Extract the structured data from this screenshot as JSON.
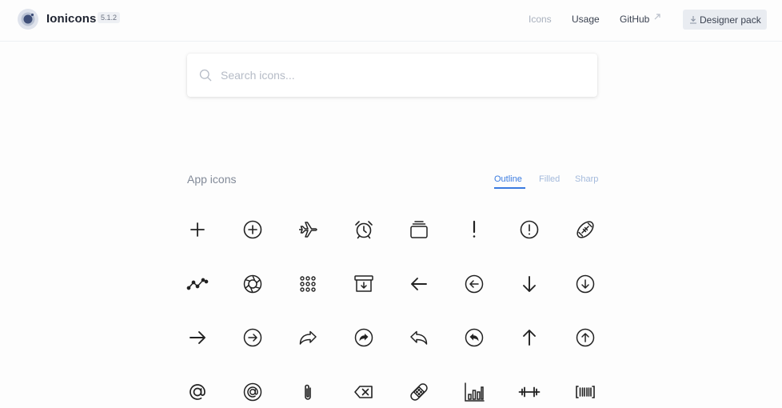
{
  "header": {
    "brand": "Ionicons",
    "version": "5.1.2",
    "nav": {
      "icons": "Icons",
      "usage": "Usage",
      "github": "GitHub"
    },
    "designer_pack": "Designer pack"
  },
  "search": {
    "placeholder": "Search icons..."
  },
  "section": {
    "title": "App icons",
    "tabs": {
      "outline": "Outline",
      "filled": "Filled",
      "sharp": "Sharp"
    },
    "active_tab": "Outline"
  },
  "icons": [
    "add-icon",
    "add-circle-icon",
    "airplane-icon",
    "alarm-icon",
    "albums-icon",
    "alert-icon",
    "alert-circle-icon",
    "american-football-icon",
    "analytics-icon",
    "aperture-icon",
    "apps-icon",
    "archive-icon",
    "arrow-back-icon",
    "arrow-back-circle-icon",
    "arrow-down-icon",
    "arrow-down-circle-icon",
    "arrow-forward-icon",
    "arrow-forward-circle-icon",
    "arrow-redo-icon",
    "arrow-redo-circle-icon",
    "arrow-undo-icon",
    "arrow-undo-circle-icon",
    "arrow-up-icon",
    "arrow-up-circle-icon",
    "at-icon",
    "at-circle-icon",
    "attach-icon",
    "backspace-icon",
    "bandage-icon",
    "bar-chart-icon",
    "barbell-icon",
    "barcode-icon"
  ],
  "colors": {
    "accent": "#3a7be0",
    "icon": "#222222",
    "muted": "#828a98"
  }
}
